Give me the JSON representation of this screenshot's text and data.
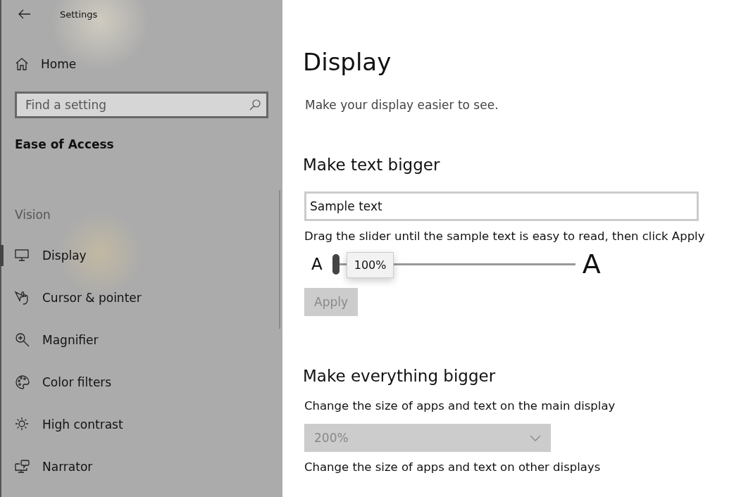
{
  "window": {
    "title": "Settings"
  },
  "sidebar": {
    "home": "Home",
    "search": {
      "placeholder": "Find a setting"
    },
    "category": "Ease of Access",
    "section": "Vision",
    "items": [
      {
        "label": "Display",
        "selected": true
      },
      {
        "label": "Cursor & pointer",
        "selected": false
      },
      {
        "label": "Magnifier",
        "selected": false
      },
      {
        "label": "Color filters",
        "selected": false
      },
      {
        "label": "High contrast",
        "selected": false
      },
      {
        "label": "Narrator",
        "selected": false
      }
    ]
  },
  "page": {
    "title": "Display",
    "subtitle": "Make your display easier to see.",
    "text_section": {
      "heading": "Make text bigger",
      "sample": "Sample text",
      "hint": "Drag the slider until the sample text is easy to read, then click Apply",
      "small_label": "A",
      "large_label": "A",
      "slider": {
        "level": 0,
        "tooltip": "100%"
      },
      "apply": {
        "label": "Apply",
        "disabled": true
      }
    },
    "everything_section": {
      "heading": "Make everything bigger",
      "main_label": "Change the size of apps and text on the main display",
      "dropdown": {
        "value": "200%",
        "disabled": true
      },
      "other_label": "Change the size of apps and text on other displays"
    }
  }
}
